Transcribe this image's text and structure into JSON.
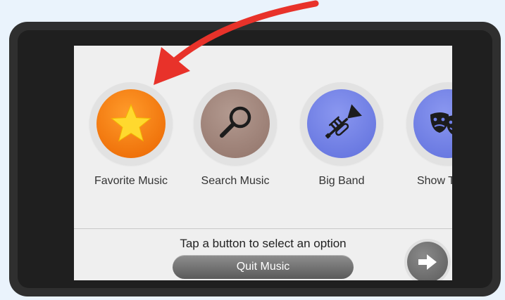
{
  "screen": {
    "options": [
      {
        "label": "Favorite Music",
        "icon": "star-icon",
        "color": "#f07a10"
      },
      {
        "label": "Search Music",
        "icon": "magnifier-icon",
        "color": "#a88b80"
      },
      {
        "label": "Big Band",
        "icon": "trumpet-icon",
        "color": "#6f7ee6"
      },
      {
        "label": "Show Tunes",
        "icon": "theater-masks-icon",
        "color": "#6f7ee6"
      }
    ],
    "hint": "Tap a button to select an option",
    "quit_label": "Quit Music",
    "next_icon": "right-arrow-icon"
  },
  "annotation": {
    "icon": "red-pointer-arrow",
    "color": "#e8322a"
  }
}
